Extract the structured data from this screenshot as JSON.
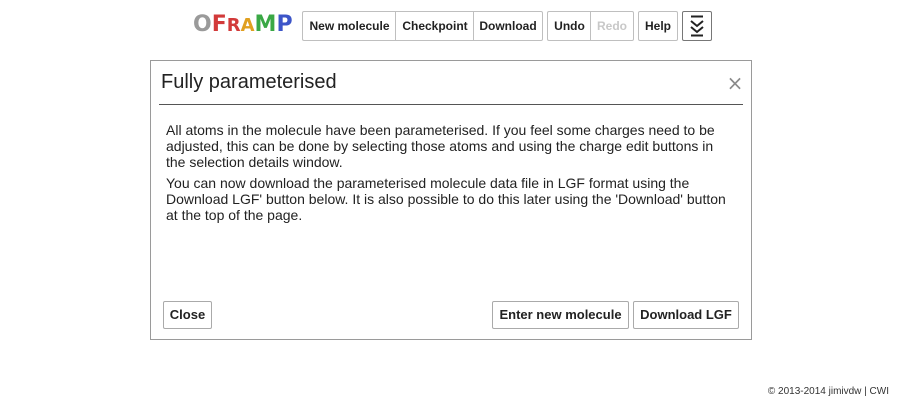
{
  "logo": {
    "letters": [
      "O",
      "F",
      "R",
      "A",
      "M",
      "P"
    ]
  },
  "toolbar": {
    "new_molecule": "New molecule",
    "checkpoint": "Checkpoint",
    "download": "Download",
    "undo": "Undo",
    "redo": "Redo",
    "help": "Help",
    "expand_icon": "double-chevron-down-icon"
  },
  "dialog": {
    "title": "Fully parameterised",
    "close_glyph": "×",
    "paragraphs": [
      "All atoms in the molecule have been parameterised. If you feel some charges need to be adjusted, this can be done by selecting those atoms and using the charge edit buttons in the selection details window.",
      "You can now download the parameterised molecule data file in LGF format using the  Download LGF' button below. It is also possible to do this later using the 'Download' button at the top of the page."
    ],
    "buttons": {
      "close": "Close",
      "enter_new": "Enter new molecule",
      "download_lgf": "Download LGF"
    }
  },
  "footer": {
    "text": "© 2013-2014 jimivdw | CWI"
  },
  "colors": {
    "logo_gray": "#9a9a9a",
    "logo_red": "#d23a3a",
    "logo_yellow": "#e0a020",
    "logo_green": "#3aa845",
    "logo_blue": "#3c55c8",
    "disabled_text": "#c8c8c8"
  }
}
